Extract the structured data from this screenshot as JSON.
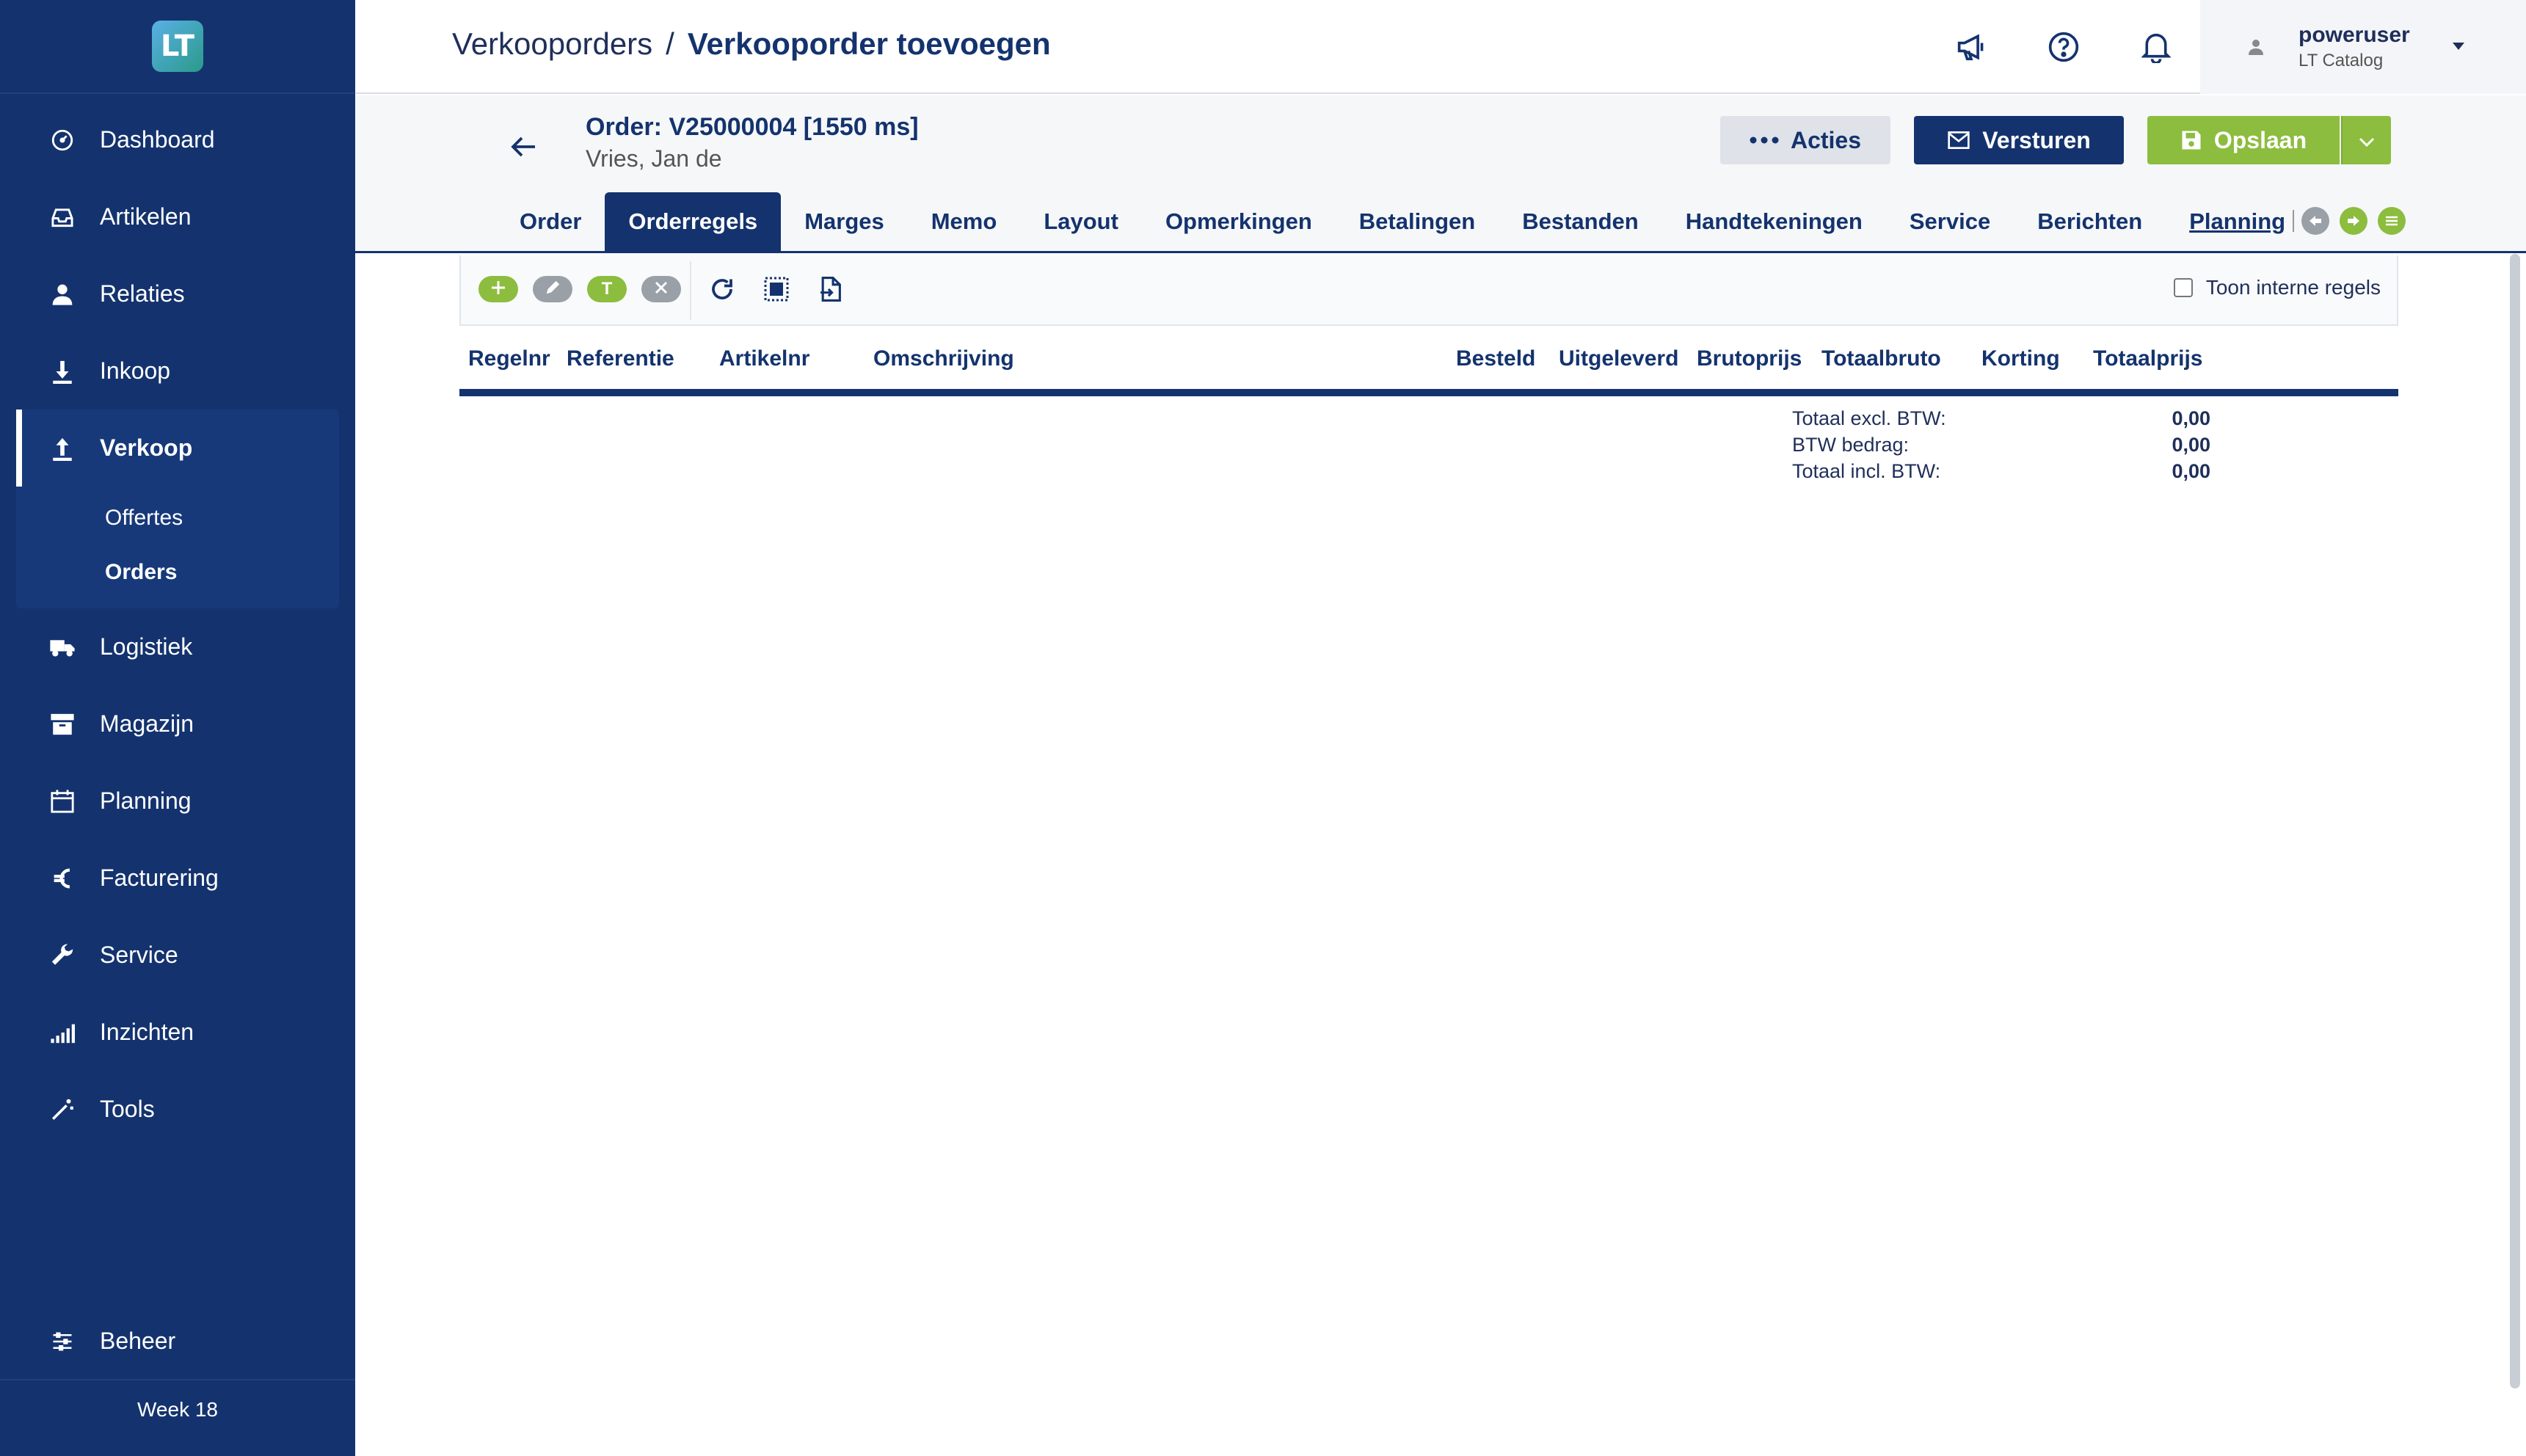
{
  "sidebar": {
    "logo_text": "LT",
    "items": [
      {
        "label": "Dashboard",
        "icon": "dashboard-icon"
      },
      {
        "label": "Artikelen",
        "icon": "inbox-icon"
      },
      {
        "label": "Relaties",
        "icon": "person-icon"
      },
      {
        "label": "Inkoop",
        "icon": "download-icon"
      },
      {
        "label": "Verkoop",
        "icon": "upload-icon",
        "active": true
      },
      {
        "label": "Logistiek",
        "icon": "truck-icon"
      },
      {
        "label": "Magazijn",
        "icon": "archive-icon"
      },
      {
        "label": "Planning",
        "icon": "calendar-icon"
      },
      {
        "label": "Facturering",
        "icon": "euro-icon"
      },
      {
        "label": "Service",
        "icon": "wrench-icon"
      },
      {
        "label": "Inzichten",
        "icon": "signal-icon"
      },
      {
        "label": "Tools",
        "icon": "wand-icon"
      }
    ],
    "subitems": [
      {
        "label": "Offertes"
      },
      {
        "label": "Orders",
        "active": true
      }
    ],
    "beheer": "Beheer",
    "week": "Week 18"
  },
  "topbar": {
    "breadcrumb_parent": "Verkooporders",
    "breadcrumb_sep": "/",
    "breadcrumb_current": "Verkooporder toevoegen",
    "user_name": "poweruser",
    "user_company": "LT Catalog"
  },
  "order": {
    "title": "Order: V25000004 [1550 ms]",
    "customer": "Vries, Jan de",
    "btn_acties": "Acties",
    "btn_versturen": "Versturen",
    "btn_opslaan": "Opslaan"
  },
  "tabs": [
    {
      "label": "Order"
    },
    {
      "label": "Orderregels",
      "active": true
    },
    {
      "label": "Marges"
    },
    {
      "label": "Memo"
    },
    {
      "label": "Layout"
    },
    {
      "label": "Opmerkingen"
    },
    {
      "label": "Betalingen"
    },
    {
      "label": "Bestanden"
    },
    {
      "label": "Handtekeningen"
    },
    {
      "label": "Service"
    },
    {
      "label": "Berichten"
    },
    {
      "label": "Planning",
      "underlined": true
    }
  ],
  "toolbar": {
    "text_button_label": "T",
    "show_internal_label": "Toon interne regels"
  },
  "table": {
    "columns": [
      "Regelnr",
      "Referentie",
      "Artikelnr",
      "Omschrijving",
      "Besteld",
      "Uitgeleverd",
      "Brutoprijs",
      "Totaalbruto",
      "Korting",
      "Totaalprijs"
    ]
  },
  "totals": [
    {
      "label": "Totaal excl. BTW:",
      "value": "0,00"
    },
    {
      "label": "BTW bedrag:",
      "value": "0,00"
    },
    {
      "label": "Totaal incl. BTW:",
      "value": "0,00"
    }
  ],
  "colors": {
    "sidebar": "#14336e",
    "accent_green": "#8cbd3e",
    "primary_navy": "#14336e"
  }
}
